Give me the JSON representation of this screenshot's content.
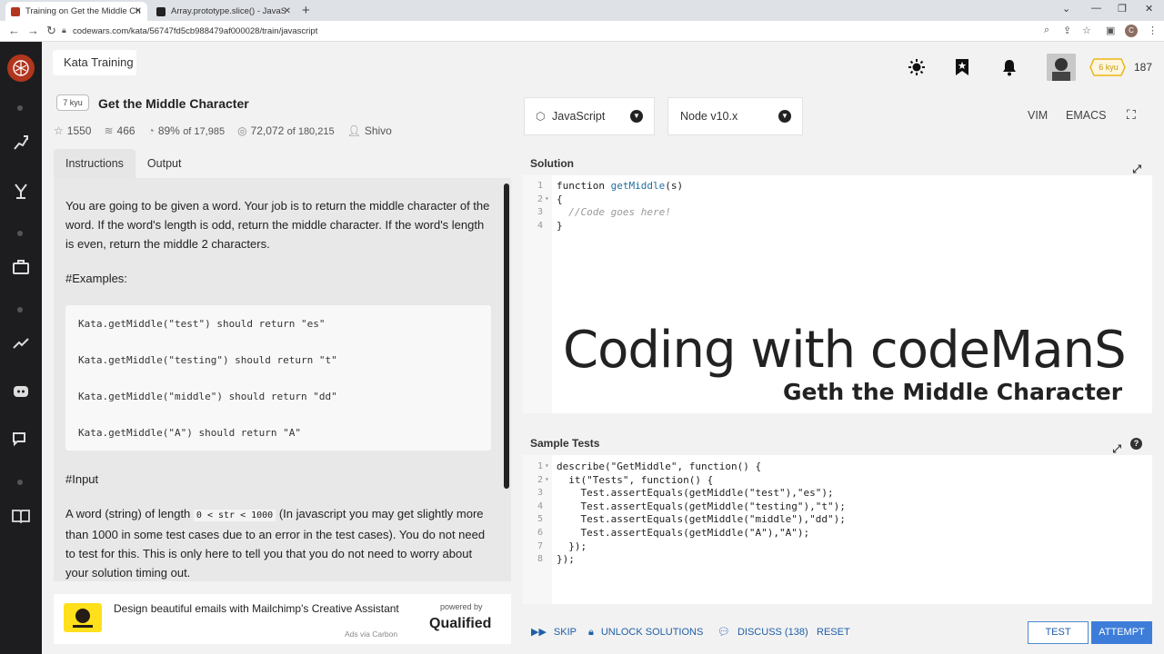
{
  "browser": {
    "tabs": [
      {
        "title": "Training on Get the Middle Chara",
        "active": true
      },
      {
        "title": "Array.prototype.slice() - JavaScrip",
        "active": false
      }
    ],
    "new_tab": "+",
    "url": "codewars.com/kata/56747fd5cb988479af000028/train/javascript",
    "profile_initial": "C"
  },
  "header": {
    "section_title": "Kata Training",
    "rank_badge": "6 kyu",
    "honor": "187"
  },
  "kata": {
    "kyu": "7 kyu",
    "title": "Get the Middle Character",
    "stats": {
      "stars": "1550",
      "collections": "466",
      "satisfaction": "89%",
      "satisfaction_of": "of 17,985",
      "completed": "72,072",
      "completed_of": "of 180,215",
      "author": "Shivo"
    },
    "tabs": [
      "Instructions",
      "Output"
    ]
  },
  "instructions": {
    "p1": "You are going to be given a word. Your job is to return the middle character of the word. If the word's length is odd, return the middle character. If the word's length is even, return the middle 2 characters.",
    "examples_heading": "#Examples:",
    "examples": [
      "Kata.getMiddle(\"test\") should return \"es\"",
      "Kata.getMiddle(\"testing\") should return \"t\"",
      "Kata.getMiddle(\"middle\") should return \"dd\"",
      "Kata.getMiddle(\"A\") should return \"A\""
    ],
    "input_heading": "#Input",
    "input_p_before": "A word (string) of length ",
    "input_code": "0 < str < 1000",
    "input_p_after": " (In javascript you may get slightly more than 1000 in some test cases due to an error in the test cases). You do not need to test for this. This is only here to tell you that you do not need to worry about your solution timing out."
  },
  "ad": {
    "text": "Design beautiful emails with Mailchimp's Creative Assistant",
    "powered_by": "powered by",
    "brand": "Qualified",
    "via": "Ads via Carbon"
  },
  "editor_settings": {
    "language": "JavaScript",
    "version": "Node v10.x",
    "modes": [
      "VIM",
      "EMACS"
    ]
  },
  "solution": {
    "title": "Solution",
    "lines": [
      {
        "num": "1",
        "fold": "",
        "text": ""
      },
      {
        "num": "2",
        "fold": "▾",
        "text": "{"
      },
      {
        "num": "3",
        "fold": "",
        "text": ""
      },
      {
        "num": "4",
        "fold": "",
        "text": "}"
      }
    ],
    "line1_kw": "function ",
    "line1_fn": "getMiddle",
    "line1_rest": "(s)",
    "line3_comment": "  //Code goes here!"
  },
  "watermark": {
    "title": "Coding with codeManS",
    "subtitle": "Geth the Middle Character"
  },
  "tests": {
    "title": "Sample Tests",
    "lines": [
      {
        "num": "1",
        "fold": "▾"
      },
      {
        "num": "2",
        "fold": "▾"
      },
      {
        "num": "3",
        "fold": ""
      },
      {
        "num": "4",
        "fold": ""
      },
      {
        "num": "5",
        "fold": ""
      },
      {
        "num": "6",
        "fold": ""
      },
      {
        "num": "7",
        "fold": ""
      },
      {
        "num": "8",
        "fold": ""
      }
    ],
    "code": [
      "describe(\"GetMiddle\", function() {",
      "  it(\"Tests\", function() {",
      "    Test.assertEquals(getMiddle(\"test\"),\"es\");",
      "    Test.assertEquals(getMiddle(\"testing\"),\"t\");",
      "    Test.assertEquals(getMiddle(\"middle\"),\"dd\");",
      "    Test.assertEquals(getMiddle(\"A\"),\"A\");",
      "  });",
      "});"
    ]
  },
  "actions": {
    "skip": "SKIP",
    "unlock": "UNLOCK SOLUTIONS",
    "discuss": "DISCUSS (138)",
    "reset": "RESET",
    "test": "TEST",
    "attempt": "ATTEMPT"
  },
  "colors": {
    "accent": "#3d7dd9",
    "logo": "#b1361e",
    "sidebar": "#1d1d1f",
    "rank": "#ecb613"
  }
}
